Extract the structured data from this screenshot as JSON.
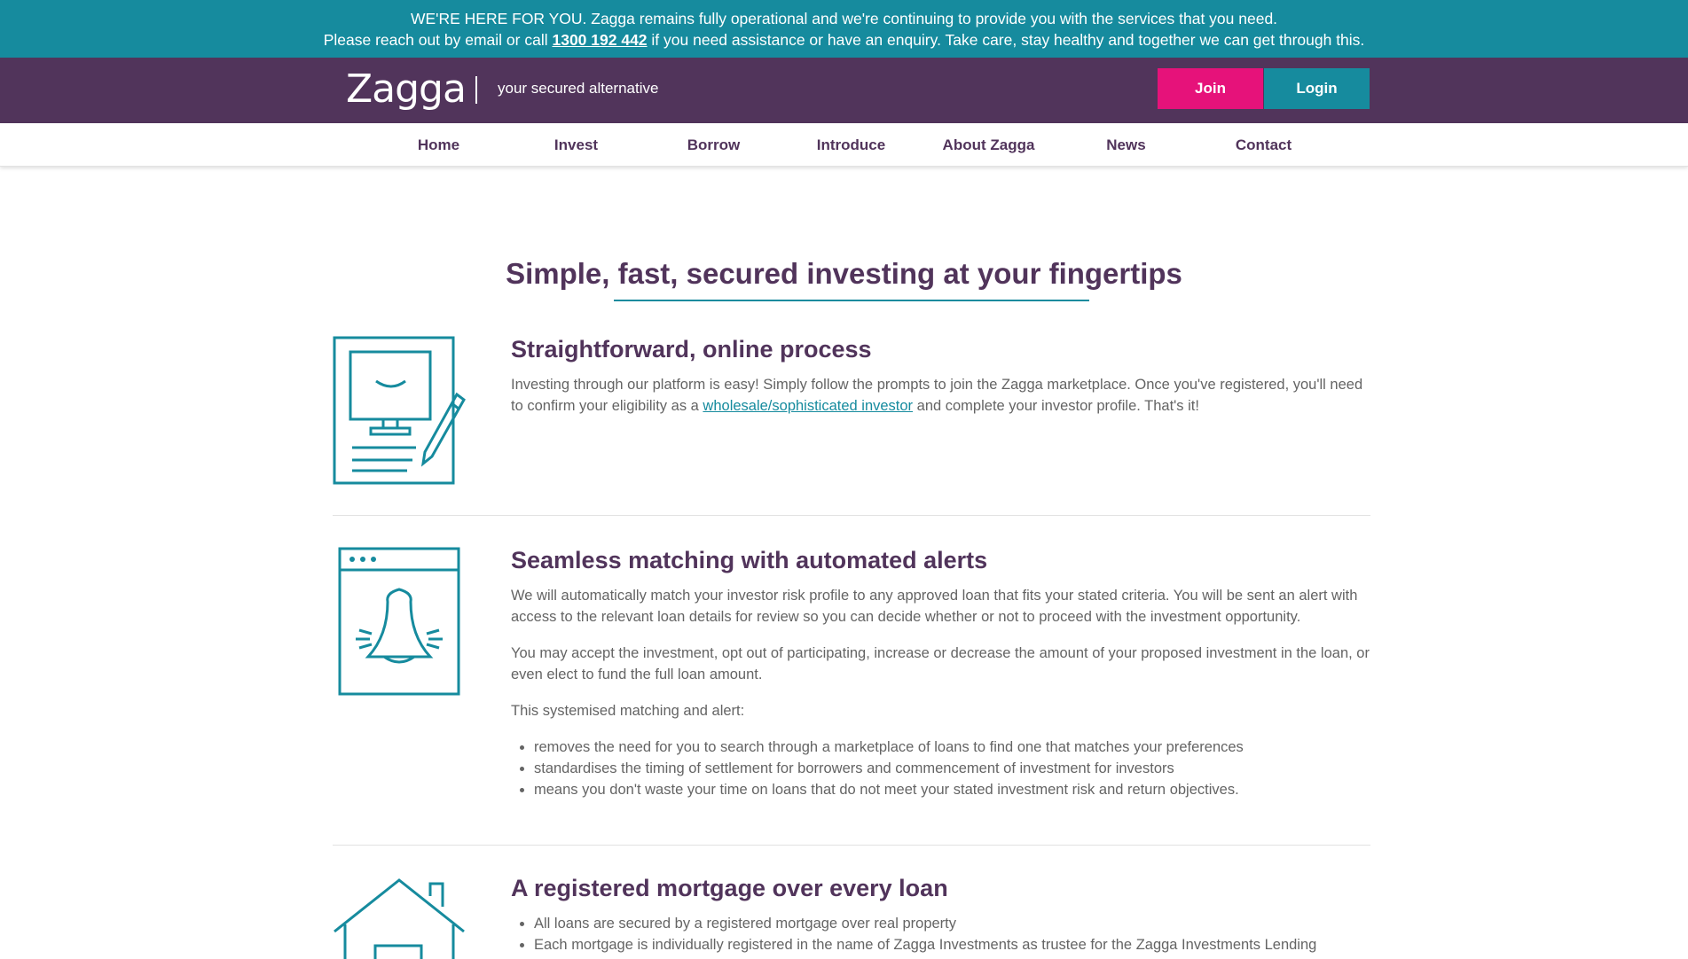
{
  "banner": {
    "line1": "WE'RE HERE FOR YOU. Zagga remains fully operational and we're continuing to provide you with the services that you need.",
    "line2_before": "Please reach out by email or call ",
    "phone": "1300 192 442",
    "line2_after": " if you need assistance or have an enquiry. Take care, stay healthy and together we can get through this."
  },
  "brand": {
    "logo": "Zagga",
    "tagline": "your secured alternative"
  },
  "header_buttons": {
    "join": "Join",
    "login": "Login"
  },
  "nav": [
    "Home",
    "Invest",
    "Borrow",
    "Introduce",
    "About Zagga",
    "News",
    "Contact"
  ],
  "hero": {
    "title": "Simple, fast, secured investing at your fingertips"
  },
  "sections": [
    {
      "title": "Straightforward, online process",
      "para_before": "Investing through our platform is easy! Simply follow the prompts to join the Zagga marketplace. Once you've registered, you'll need to confirm your eligibility as a ",
      "link": "wholesale/sophisticated investor",
      "para_after": " and complete your investor profile. That's it!"
    },
    {
      "title": "Seamless matching with automated alerts",
      "paragraphs": [
        "We will automatically match your investor risk profile to any approved loan that fits your stated criteria. You will be sent an alert with access to the relevant loan details for review so you can decide whether or not to proceed with the investment opportunity.",
        "You may accept the investment, opt out of participating, increase or decrease the amount of your proposed investment in the loan, or even elect to fund the full loan amount.",
        "This systemised matching and alert:"
      ],
      "bullets": [
        "removes the need for you to search through a marketplace of loans to find one that matches your preferences",
        "standardises the timing of settlement for borrowers and commencement of investment for investors",
        "means you don't waste your time on loans that do not meet your stated investment risk and return objectives."
      ]
    },
    {
      "title": "A registered mortgage over every loan",
      "bullets": [
        "All loans are secured by a registered mortgage over real property",
        "Each mortgage is individually registered in the name of Zagga Investments as trustee for the Zagga Investments Lending"
      ]
    }
  ],
  "colors": {
    "teal": "#168b9e",
    "purple": "#51345b",
    "pink": "#e6127a"
  }
}
